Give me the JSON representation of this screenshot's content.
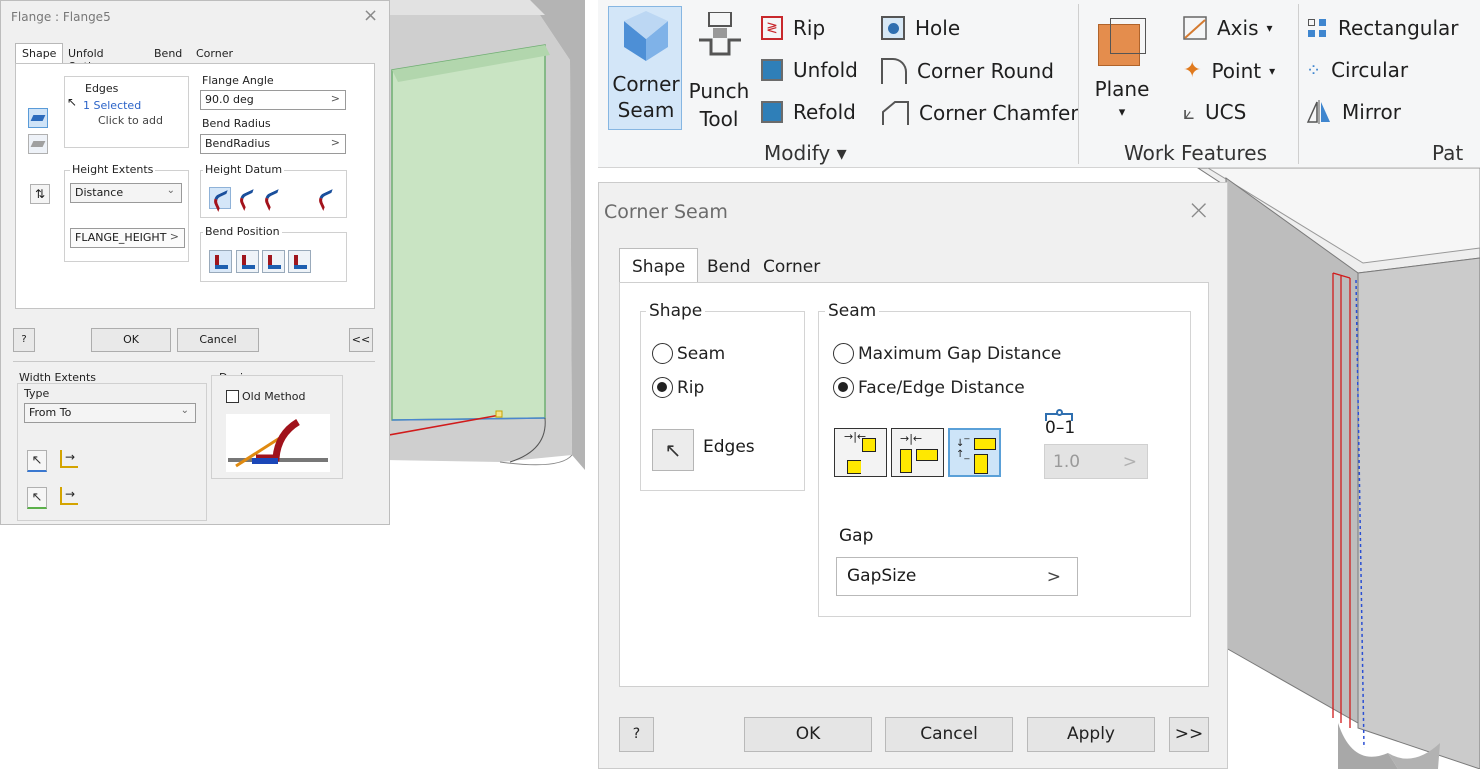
{
  "flange_dialog": {
    "title": "Flange : Flange5",
    "close": "×",
    "tabs": [
      "Shape",
      "Unfold Options",
      "Bend",
      "Corner"
    ],
    "edges": {
      "title": "Edges",
      "selected": "1 Selected",
      "hint": "Click to add"
    },
    "flange_angle": {
      "label": "Flange Angle",
      "value": "90.0 deg",
      "chevron": ">"
    },
    "bend_radius": {
      "label": "Bend Radius",
      "value": "BendRadius",
      "chevron": ">"
    },
    "height_extents": {
      "label": "Height Extents",
      "value": "Distance",
      "field": "FLANGE_HEIGHT",
      "chevron": ">"
    },
    "height_datum": {
      "label": "Height Datum"
    },
    "bend_position": {
      "label": "Bend Position"
    },
    "ok": "OK",
    "cancel": "Cancel",
    "more": "<<",
    "help": "?",
    "width_extents": {
      "label": "Width Extents",
      "type_label": "Type",
      "type_value": "From To"
    },
    "design": {
      "label": "Design",
      "old_method": "Old Method"
    }
  },
  "ribbon": {
    "corner_seam": [
      "Corner",
      "Seam"
    ],
    "punch_tool": [
      "Punch",
      "Tool"
    ],
    "rip": "Rip",
    "unfold": "Unfold",
    "refold": "Refold",
    "hole": "Hole",
    "corner_round": "Corner Round",
    "corner_chamfer": "Corner Chamfer",
    "modify_group": "Modify ▾",
    "plane": "Plane",
    "plane_dd": "▾",
    "axis": "Axis",
    "point": "Point",
    "ucs": "UCS",
    "work_features_group": "Work Features",
    "rectangular": "Rectangular",
    "circular": "Circular",
    "mirror": "Mirror",
    "pattern_group": "Pat",
    "dd": "▾"
  },
  "corner_seam_dialog": {
    "title": "Corner Seam",
    "close": "×",
    "tabs": [
      "Shape",
      "Bend",
      "Corner"
    ],
    "shape_group": "Shape",
    "shape_options": [
      "Seam",
      "Rip"
    ],
    "shape_selected": "Rip",
    "edges_label": "Edges",
    "seam_group": "Seam",
    "seam_options": [
      "Maximum Gap Distance",
      "Face/Edge Distance"
    ],
    "seam_selected": "Face/Edge Distance",
    "ratio_tick": "0–1",
    "ratio_value": "1.0",
    "ratio_chevron": ">",
    "gap_label": "Gap",
    "gap_value": "GapSize",
    "gap_chevron": ">",
    "help": "?",
    "ok": "OK",
    "cancel": "Cancel",
    "apply": "Apply",
    "expand": ">>"
  }
}
